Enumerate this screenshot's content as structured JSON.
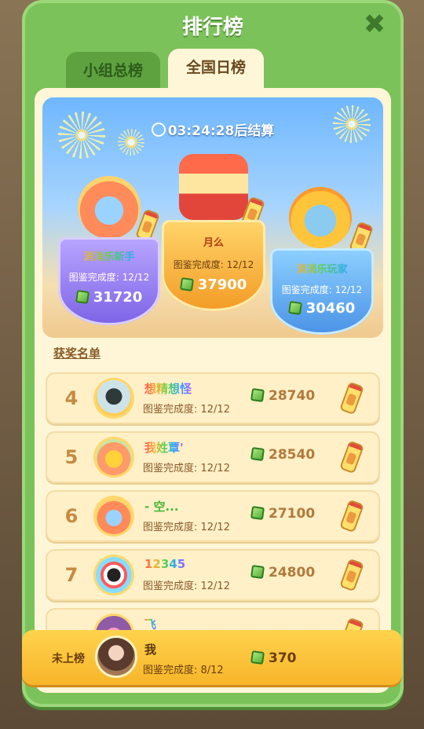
{
  "header": {
    "title": "排行榜",
    "close_icon": "close-icon"
  },
  "tabs": [
    {
      "label": "小组总榜",
      "active": false
    },
    {
      "label": "全国日榜",
      "active": true
    }
  ],
  "timer": {
    "text": "03:24:28后结算",
    "icon": "clock-icon"
  },
  "podium": [
    {
      "place": 2,
      "name": "消消乐新手",
      "progress": "图鉴完成度: 12/12",
      "score": "31720"
    },
    {
      "place": 1,
      "name": "月么",
      "progress": "图鉴完成度: 12/12",
      "score": "37900"
    },
    {
      "place": 3,
      "name": "消消乐玩家",
      "progress": "图鉴完成度: 12/12",
      "score": "30460"
    }
  ],
  "winners_label": "获奖名单",
  "rows": [
    {
      "rank": "4",
      "name": "想精想怪",
      "progress": "图鉴完成度: 12/12",
      "score": "28740"
    },
    {
      "rank": "5",
      "name": "我姓覃'",
      "progress": "图鉴完成度: 12/12",
      "score": "28540"
    },
    {
      "rank": "6",
      "name": "- 空...",
      "progress": "图鉴完成度: 12/12",
      "score": "27100"
    },
    {
      "rank": "7",
      "name": "12345",
      "progress": "图鉴完成度: 12/12",
      "score": "24800"
    },
    {
      "rank": "",
      "name": "飞",
      "progress": "",
      "score": ""
    }
  ],
  "mine": {
    "label": "未上榜",
    "name": "我",
    "progress": "图鉴完成度: 8/12",
    "score": "370"
  },
  "colors": {
    "panel": "#7cc25a",
    "inner": "#fff6d8",
    "row": "#fff0c8",
    "mine": "#ffd34d"
  }
}
